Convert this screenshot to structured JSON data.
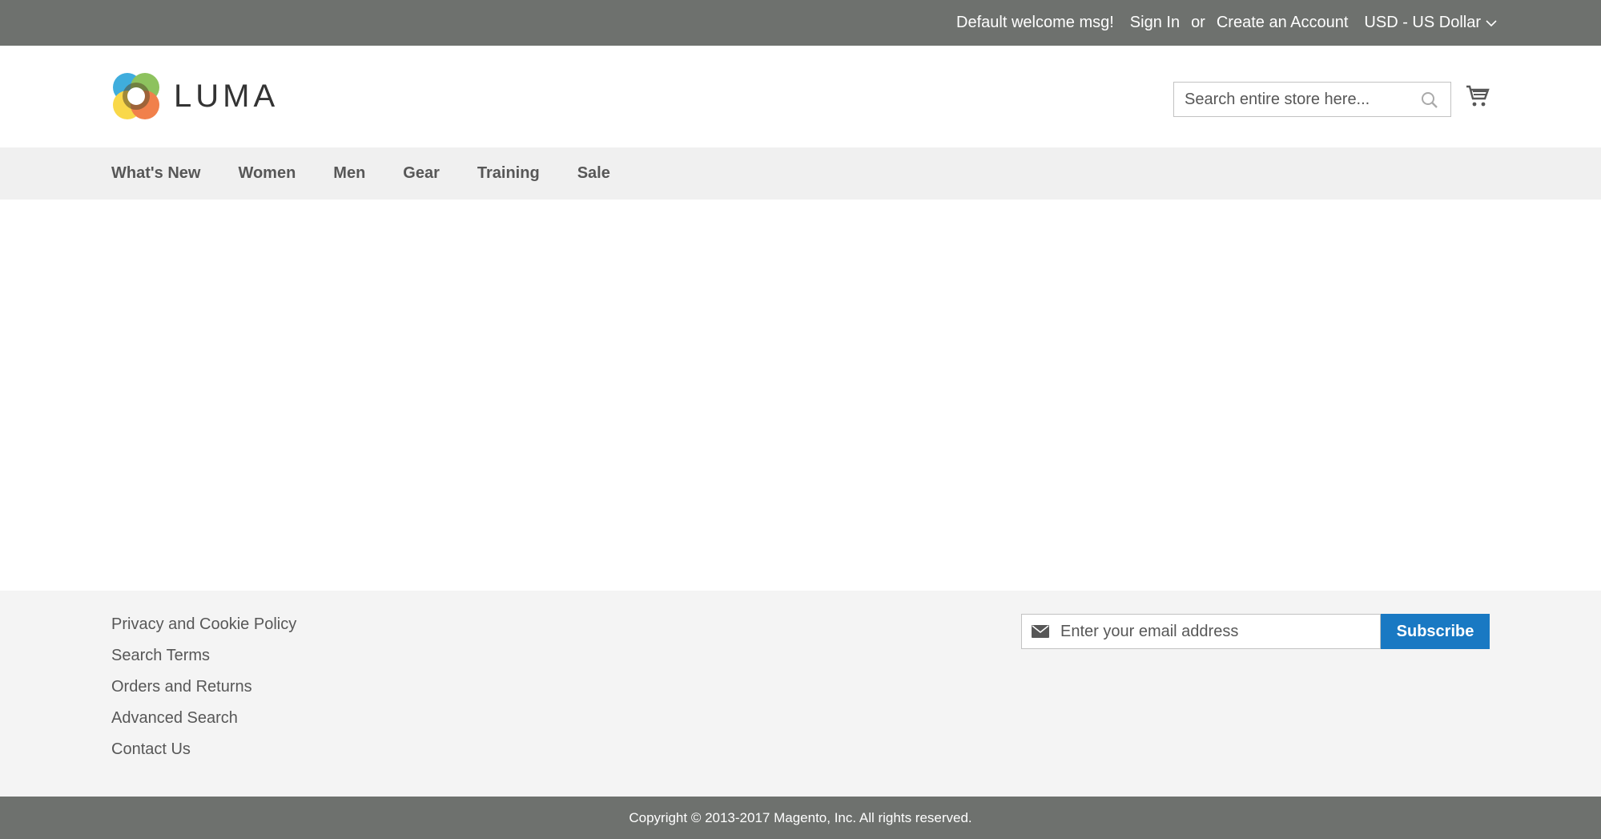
{
  "topbar": {
    "welcome": "Default welcome msg!",
    "sign_in": "Sign In",
    "or": "or",
    "create_account": "Create an Account",
    "currency": "USD - US Dollar"
  },
  "header": {
    "logo_text": "LUMA",
    "search_placeholder": "Search entire store here...",
    "icons": {
      "search": "search-icon",
      "cart": "cart-icon"
    }
  },
  "nav": {
    "items": [
      {
        "label": "What's New"
      },
      {
        "label": "Women"
      },
      {
        "label": "Men"
      },
      {
        "label": "Gear"
      },
      {
        "label": "Training"
      },
      {
        "label": "Sale"
      }
    ]
  },
  "footer": {
    "links": [
      {
        "label": "Privacy and Cookie Policy"
      },
      {
        "label": "Search Terms"
      },
      {
        "label": "Orders and Returns"
      },
      {
        "label": "Advanced Search"
      },
      {
        "label": "Contact Us"
      }
    ],
    "newsletter": {
      "placeholder": "Enter your email address",
      "button": "Subscribe"
    },
    "copyright": "Copyright © 2013-2017 Magento, Inc. All rights reserved."
  },
  "colors": {
    "topbar": "#6e716e",
    "accent": "#1979c3",
    "nav_bg": "#f0f0f0",
    "footer_bg": "#f4f4f4"
  }
}
